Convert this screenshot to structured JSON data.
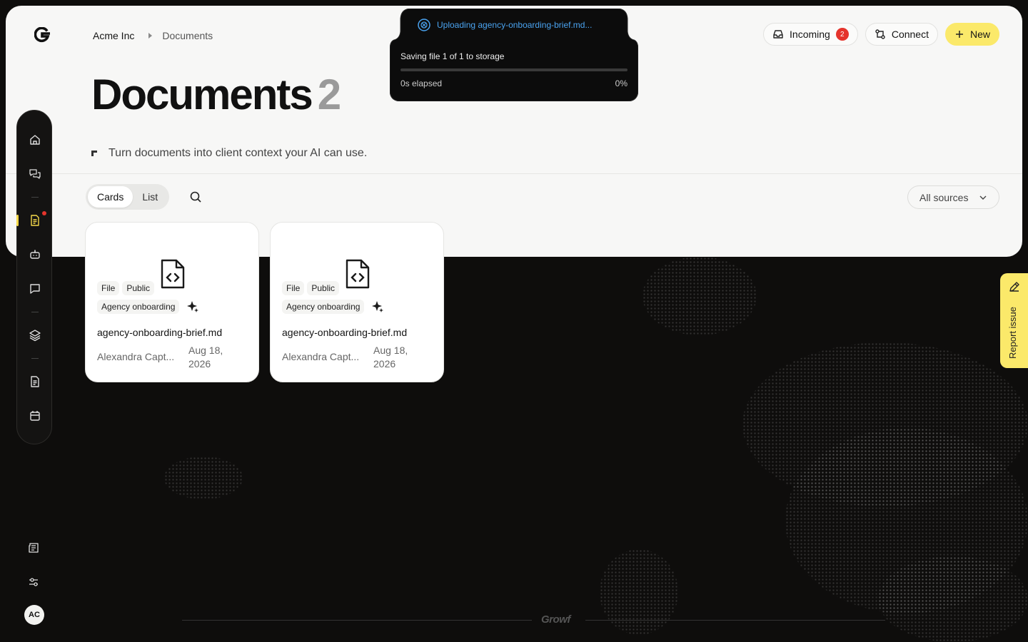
{
  "app": {
    "brand": "Growf"
  },
  "breadcrumb": {
    "root": "Acme Inc",
    "current": "Documents"
  },
  "page": {
    "title": "Documents",
    "count": "2",
    "subtitle": "Turn documents into client context your AI can use."
  },
  "top_actions": {
    "incoming_label": "Incoming",
    "incoming_count": "2",
    "connect_label": "Connect",
    "new_label": "New"
  },
  "view_toggle": {
    "cards": "Cards",
    "list": "List",
    "active": "cards"
  },
  "filter": {
    "selected": "All sources"
  },
  "documents": [
    {
      "type_tag": "File",
      "visibility_tag": "Public",
      "category_tag": "Agency onboarding",
      "filename": "agency-onboarding-brief.md",
      "author": "Alexandra Capt...",
      "date": "Aug 18, 2026"
    },
    {
      "type_tag": "File",
      "visibility_tag": "Public",
      "category_tag": "Agency onboarding",
      "filename": "agency-onboarding-brief.md",
      "author": "Alexandra Capt...",
      "date": "Aug 18, 2026"
    }
  ],
  "upload_toast": {
    "title": "Uploading agency-onboarding-brief.md...",
    "message": "Saving file 1 of 1 to storage",
    "elapsed": "0s elapsed",
    "percent_label": "0%",
    "progress": 0
  },
  "report": {
    "label": "Report issue"
  },
  "user": {
    "initials": "AC"
  },
  "sidebar": {
    "items": [
      "home-icon",
      "chats-icon",
      "documents-icon",
      "bot-icon",
      "message-icon",
      "layers-icon",
      "page-icon",
      "calendar-icon"
    ],
    "active": "documents-icon"
  },
  "colors": {
    "accent": "#fbe96a",
    "badge": "#e5342c",
    "upload": "#4aa3f0"
  }
}
